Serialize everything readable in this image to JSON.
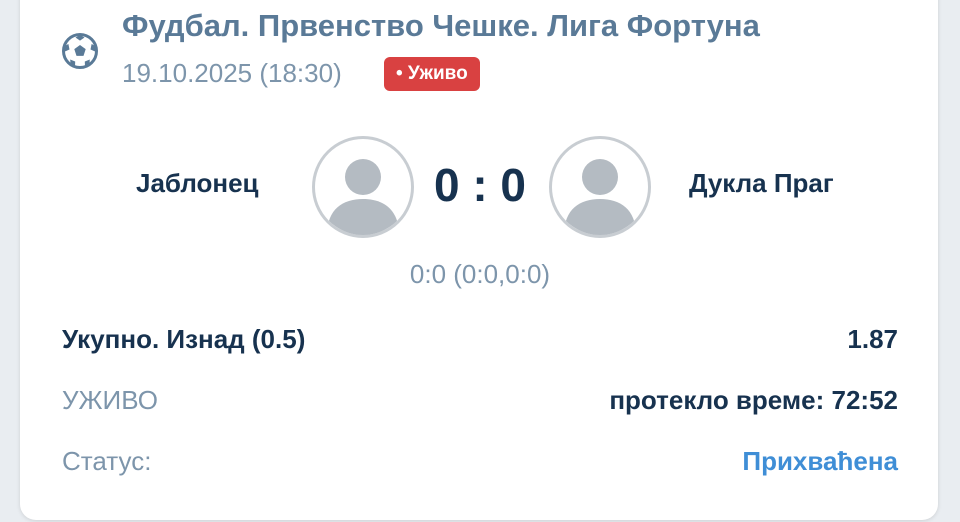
{
  "event": {
    "sport_icon": "soccer-ball-icon",
    "league": "Фудбал. Првенство Чешке. Лига Фортуна",
    "datetime": "19.10.2025 (18:30)",
    "live_badge": "• Уживо"
  },
  "match": {
    "home_team": "Јаблонец",
    "away_team": "Дукла Праг",
    "score": "0 : 0",
    "subscore": "0:0 (0:0,0:0)",
    "home_avatar_icon": "user-avatar-icon",
    "away_avatar_icon": "user-avatar-icon"
  },
  "bet": {
    "market": "Укупно. Изнад (0.5)",
    "odds": "1.87",
    "mode": "УЖИВО",
    "elapsed": "протекло време: 72:52",
    "status_label": "Статус:",
    "status_value": "Прихваћена"
  },
  "colors": {
    "live_badge_bg": "#d94141",
    "status_accepted": "#3f8ed6",
    "primary_text": "#17324f",
    "muted_text": "#7d95ab"
  }
}
